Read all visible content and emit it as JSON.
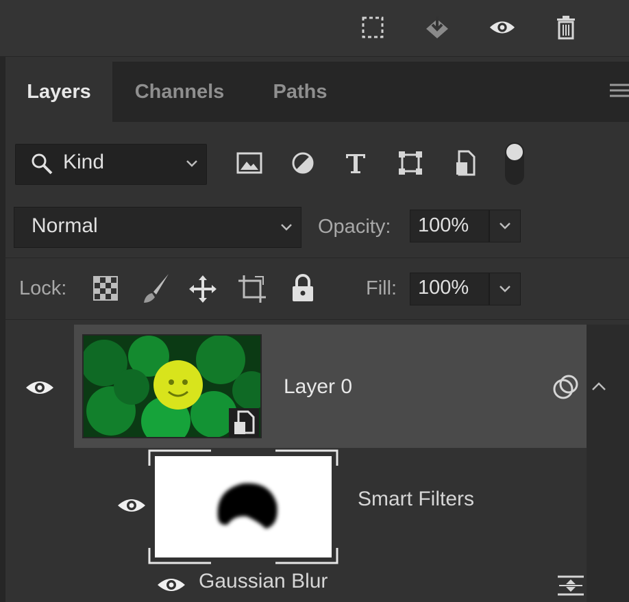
{
  "toolbar": {
    "icons": [
      "selection-marquee-icon",
      "merge-down-icon",
      "visibility-eye-icon",
      "trash-icon"
    ]
  },
  "tabs": [
    {
      "label": "Layers",
      "active": true
    },
    {
      "label": "Channels",
      "active": false
    },
    {
      "label": "Paths",
      "active": false
    }
  ],
  "filter": {
    "kind_label": "Kind",
    "icons": [
      "image-filter-icon",
      "adjustment-filter-icon",
      "type-filter-icon",
      "shape-filter-icon",
      "smart-object-filter-icon"
    ]
  },
  "blend": {
    "mode": "Normal",
    "opacity_label": "Opacity:",
    "opacity_value": "100%"
  },
  "lock": {
    "label": "Lock:",
    "icons": [
      "lock-transparent-pixels-icon",
      "lock-image-pixels-icon",
      "lock-position-icon",
      "lock-artboard-icon",
      "lock-all-icon"
    ],
    "fill_label": "Fill:",
    "fill_value": "100%"
  },
  "layers": [
    {
      "name": "Layer 0",
      "visible": true,
      "smart_object": true,
      "selected": true
    }
  ],
  "smart_filters": {
    "label": "Smart Filters",
    "filters": [
      {
        "name": "Gaussian Blur",
        "visible": true
      }
    ]
  },
  "colors": {
    "panel_bg": "#323232",
    "selected_row": "#4a4a4a",
    "text": "#d6d6d6"
  }
}
